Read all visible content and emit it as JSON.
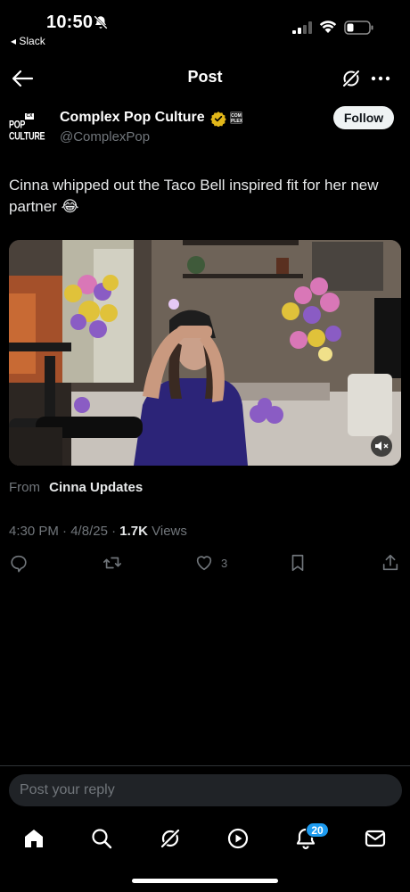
{
  "status_bar": {
    "time": "10:50",
    "back_app": "◂ Slack",
    "icons": [
      "bell-off-icon",
      "signal-icon",
      "wifi-icon",
      "battery-icon"
    ]
  },
  "header": {
    "title": "Post",
    "icons": [
      "back-arrow-icon",
      "grok-icon",
      "more-icon"
    ]
  },
  "post": {
    "author": {
      "name": "Complex Pop Culture",
      "handle": "@ComplexPop",
      "avatar_text_top": "CX",
      "avatar_text": "POP CULTURE",
      "verified": true,
      "affiliate_badge": "COM PLEX"
    },
    "follow_label": "Follow",
    "text": "Cinna whipped out the Taco Bell inspired fit for her new partner 😂",
    "source_prefix": "From",
    "source_name": "Cinna Updates",
    "time": "4:30 PM",
    "date": "4/8/25",
    "views_count": "1.7K",
    "views_label": "Views",
    "likes": "3",
    "actions": [
      "reply-icon",
      "repost-icon",
      "like-icon",
      "bookmark-icon",
      "share-icon"
    ]
  },
  "reply": {
    "placeholder": "Post your reply"
  },
  "tabbar": {
    "tabs": [
      "home-icon",
      "search-icon",
      "grok-icon",
      "video-icon",
      "notifications-icon",
      "messages-icon"
    ],
    "notification_badge": "20"
  },
  "colors": {
    "accent": "#1d9bf0",
    "muted": "#71767b",
    "verified_gold": "#e2b719",
    "background": "#000000"
  }
}
